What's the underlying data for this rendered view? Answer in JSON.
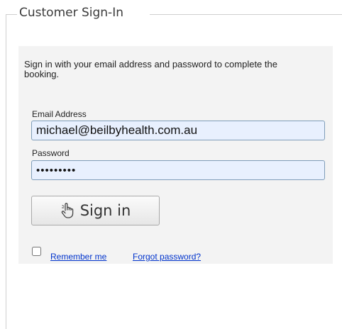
{
  "fieldset": {
    "legend": "Customer Sign-In"
  },
  "intro_text": "Sign in with your email address and password to complete the booking.",
  "email": {
    "label": "Email Address",
    "value": "michael@beilbyhealth.com.au"
  },
  "password": {
    "label": "Password",
    "value": "•••••••••"
  },
  "signin_button": {
    "label": "Sign in",
    "icon": "hand-pointer-icon"
  },
  "remember_me": {
    "checked": false,
    "label": "Remember me"
  },
  "forgot_password": {
    "label": "Forgot password?"
  },
  "colors": {
    "panel_background": "#f3f3f3",
    "input_background": "#e8f0fe",
    "input_border": "#7f9db9",
    "link": "#0033cc"
  }
}
